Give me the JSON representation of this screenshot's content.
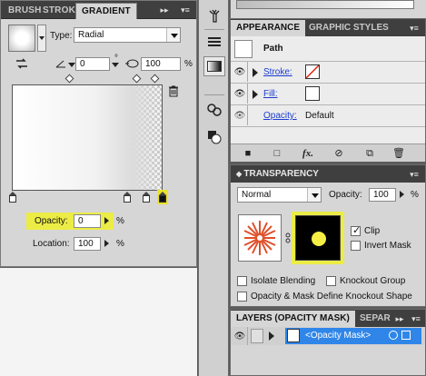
{
  "gradient_panel": {
    "tabs": [
      "BRUSH",
      "STROK",
      "GRADIENT"
    ],
    "type_label": "Type:",
    "type_value": "Radial",
    "angle_value": "0",
    "degree_symbol": "°",
    "aspect_value": "100",
    "percent": "%",
    "opacity_label": "Opacity:",
    "opacity_value": "0",
    "location_label": "Location:",
    "location_value": "100"
  },
  "appearance_panel": {
    "tabs": [
      "APPEARANCE",
      "GRAPHIC STYLES"
    ],
    "object_label": "Path",
    "stroke_label": "Stroke:",
    "fill_label": "Fill:",
    "opacity_label": "Opacity:",
    "opacity_value": "Default",
    "footer_icons": [
      "new-art-icon",
      "clear-appearance-icon",
      "fx-icon",
      "no-icon",
      "duplicate-icon",
      "trash-icon"
    ]
  },
  "transparency_panel": {
    "title": "TRANSPARENCY",
    "blend_mode": "Normal",
    "opacity_label": "Opacity:",
    "opacity_value": "100",
    "percent": "%",
    "clip_label": "Clip",
    "clip_checked": true,
    "invert_mask_label": "Invert Mask",
    "invert_mask_checked": false,
    "isolate_blending_label": "Isolate Blending",
    "knockout_group_label": "Knockout Group",
    "opacity_mask_label": "Opacity & Mask Define Knockout Shape"
  },
  "layers_panel": {
    "tabs": [
      "LAYERS (OPACITY MASK)",
      "SEPAR"
    ],
    "row_label": "<Opacity Mask>"
  },
  "colors": {
    "highlight": "#ecec47",
    "selection_blue": "#2f86e8",
    "panel_dark": "#3f3f3f",
    "panel_light": "#d6d6d6"
  }
}
